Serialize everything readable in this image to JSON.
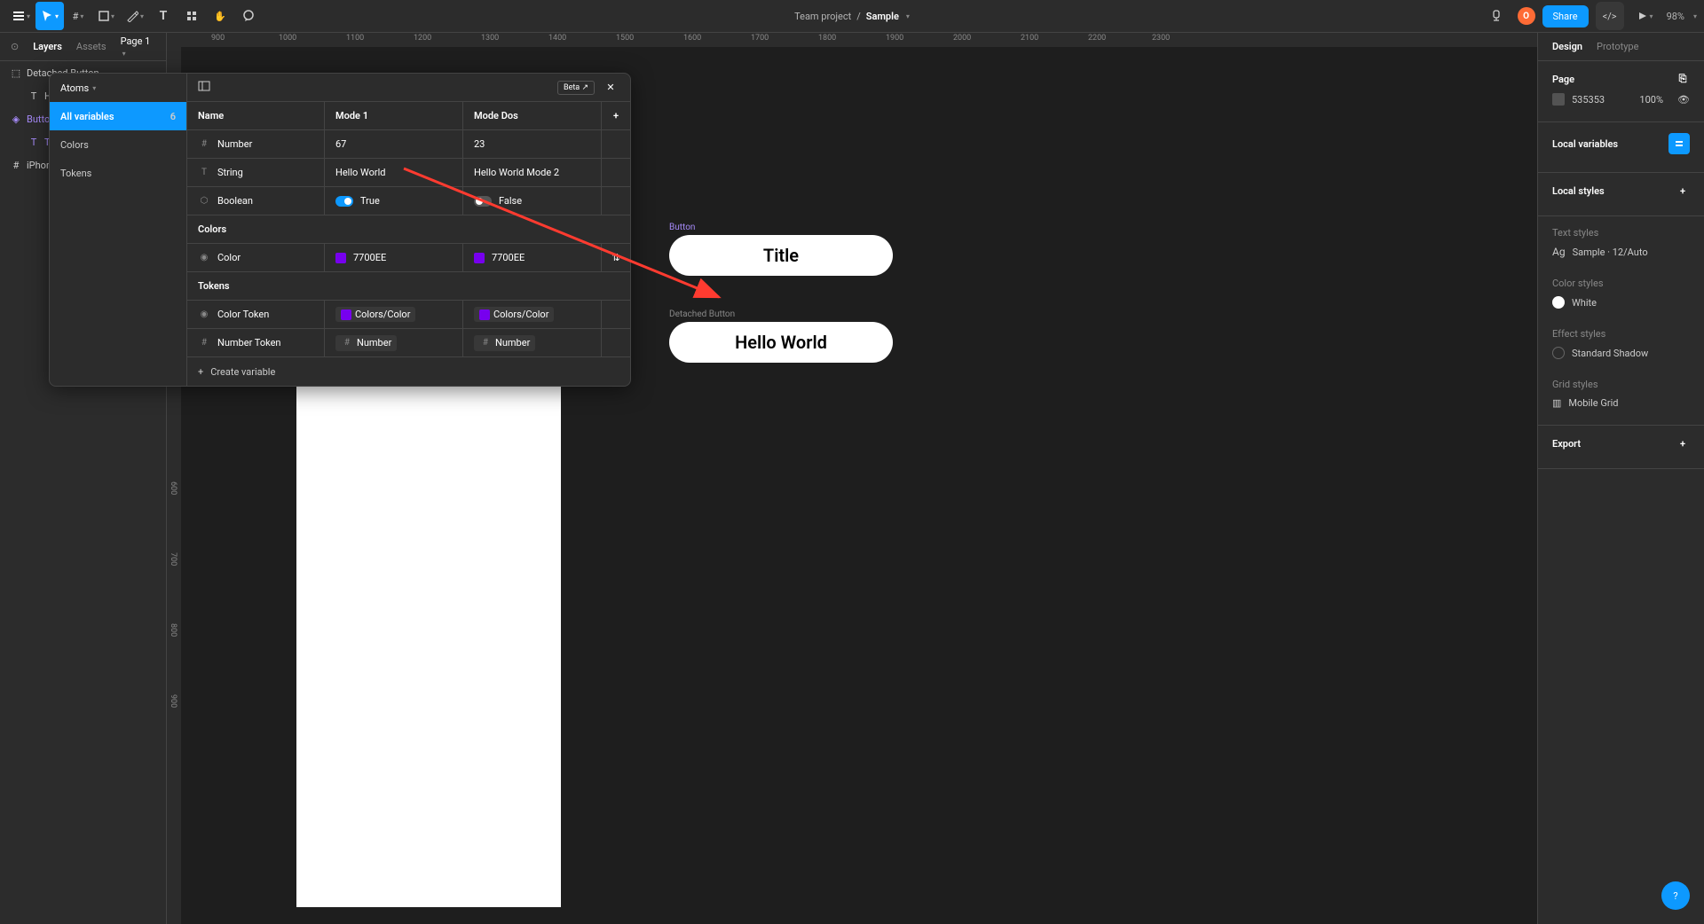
{
  "toolbar": {
    "project": "Team project",
    "file": "Sample",
    "avatar_letter": "O",
    "share_label": "Share",
    "zoom": "98%"
  },
  "left_panel": {
    "tabs": [
      "Layers",
      "Assets"
    ],
    "page_label": "Page 1",
    "layers": [
      {
        "name": "Detached Button",
        "type": "instance"
      },
      {
        "name": "H",
        "type": "text",
        "indent": 1
      },
      {
        "name": "Button",
        "type": "component"
      },
      {
        "name": "T",
        "type": "text",
        "indent": 1
      },
      {
        "name": "iPhon",
        "type": "frame"
      }
    ]
  },
  "ruler_h": [
    900,
    1000,
    1100,
    1200,
    1300,
    1400,
    1500,
    1600,
    1700,
    1800,
    1900,
    2000,
    2100,
    2200,
    2300
  ],
  "ruler_v": [
    600,
    700,
    800,
    900
  ],
  "canvas": {
    "button_label": "Button",
    "button_title": "Title",
    "detached_label": "Detached Button",
    "detached_text": "Hello World"
  },
  "variables_modal": {
    "collection": "Atoms",
    "beta": "Beta",
    "sidebar": [
      {
        "label": "All variables",
        "count": "6",
        "active": true
      },
      {
        "label": "Colors"
      },
      {
        "label": "Tokens"
      }
    ],
    "columns": [
      "Name",
      "Mode 1",
      "Mode Dos"
    ],
    "rows": [
      {
        "type": "number",
        "name": "Number",
        "v1": "67",
        "v2": "23"
      },
      {
        "type": "string",
        "name": "String",
        "v1": "Hello World",
        "v2": "Hello World Mode 2"
      },
      {
        "type": "boolean",
        "name": "Boolean",
        "v1_on": true,
        "v1_label": "True",
        "v2_on": false,
        "v2_label": "False"
      }
    ],
    "section_colors": "Colors",
    "color_row": {
      "name": "Color",
      "v1": "7700EE",
      "v2": "7700EE",
      "swatch": "#7700EE"
    },
    "section_tokens": "Tokens",
    "token_rows": [
      {
        "type": "color",
        "name": "Color Token",
        "v1": "Colors/Color",
        "v2": "Colors/Color",
        "swatch": "#7700EE"
      },
      {
        "type": "number",
        "name": "Number Token",
        "v1": "Number",
        "v2": "Number"
      }
    ],
    "create_label": "Create variable"
  },
  "right_panel": {
    "tabs": [
      "Design",
      "Prototype"
    ],
    "page_label": "Page",
    "bg_color": "535353",
    "bg_pct": "100%",
    "local_vars": "Local variables",
    "local_styles": "Local styles",
    "text_styles": "Text styles",
    "text_sample": "Sample · 12/Auto",
    "text_ag": "Ag",
    "color_styles": "Color styles",
    "white_label": "White",
    "effect_styles": "Effect styles",
    "shadow_label": "Standard Shadow",
    "grid_styles": "Grid styles",
    "grid_label": "Mobile Grid",
    "export": "Export"
  }
}
